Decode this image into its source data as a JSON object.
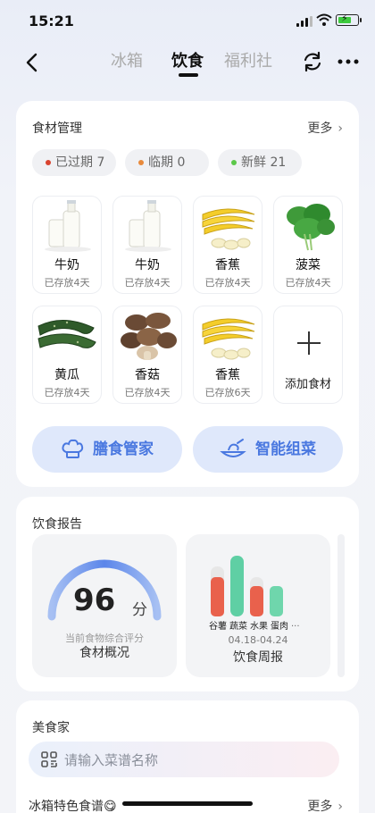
{
  "status": {
    "time": "15:21",
    "battery": "⚡"
  },
  "nav": {
    "tabs": [
      {
        "label": "冰箱",
        "active": false
      },
      {
        "label": "饮食",
        "active": true
      },
      {
        "label": "福利社",
        "active": false
      }
    ]
  },
  "ingredients": {
    "title": "食材管理",
    "more": "更多",
    "filters": [
      {
        "label": "已过期 7",
        "color": "#d9432f"
      },
      {
        "label": "临期 0",
        "color": "#e88a3c"
      },
      {
        "label": "新鲜 21",
        "color": "#5cc84a"
      }
    ],
    "items": [
      {
        "name": "牛奶",
        "days": "已存放4天",
        "icon": "milk-icon"
      },
      {
        "name": "牛奶",
        "days": "已存放4天",
        "icon": "milk-icon"
      },
      {
        "name": "香蕉",
        "days": "已存放4天",
        "icon": "banana-icon"
      },
      {
        "name": "菠菜",
        "days": "已存放4天",
        "icon": "spinach-icon"
      },
      {
        "name": "黄瓜",
        "days": "已存放4天",
        "icon": "cucumber-icon"
      },
      {
        "name": "香菇",
        "days": "已存放4天",
        "icon": "mushroom-icon"
      },
      {
        "name": "香蕉",
        "days": "已存放6天",
        "icon": "banana-icon"
      }
    ],
    "add_label": "添加食材",
    "buttons": {
      "butler": "膳食管家",
      "smart": "智能组菜"
    }
  },
  "report": {
    "title": "饮食报告",
    "score": "96",
    "score_unit": "分",
    "score_caption": "当前食物综合评分",
    "overview_title": "食材概况",
    "weekly": {
      "labels": [
        "谷薯",
        "蔬菜",
        "水果",
        "蛋肉"
      ],
      "more": "···",
      "date_range": "04.18-04.24",
      "title": "饮食周报"
    }
  },
  "gourmet": {
    "title": "美食家",
    "search_placeholder": "请输入菜谱名称",
    "recipes_title": "冰箱特色食谱😋",
    "recipes_more": "更多"
  }
}
